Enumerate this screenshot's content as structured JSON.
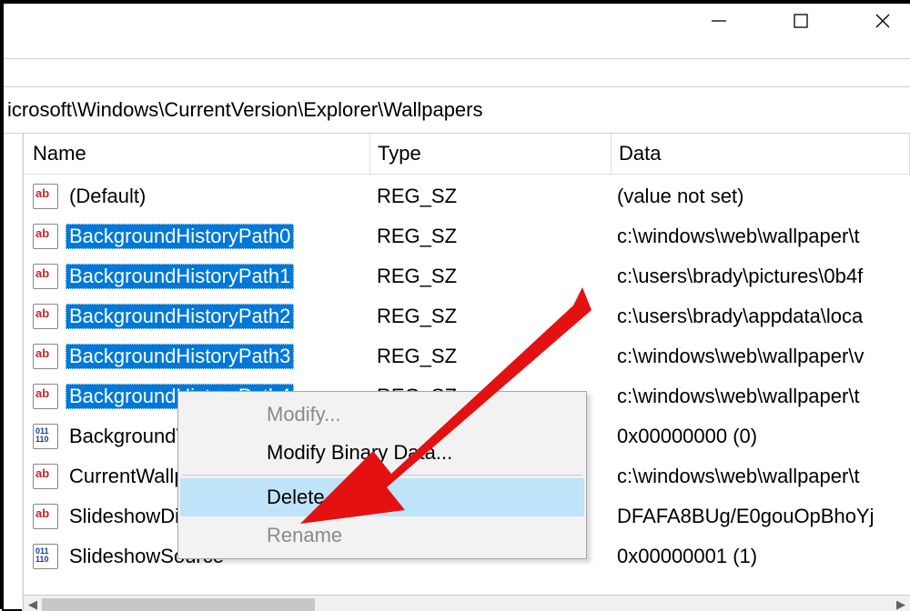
{
  "address": "icrosoft\\Windows\\CurrentVersion\\Explorer\\Wallpapers",
  "columns": {
    "name": "Name",
    "type": "Type",
    "data": "Data"
  },
  "rows": [
    {
      "name": "(Default)",
      "type": "REG_SZ",
      "data": "(value not set)",
      "icon": "ab",
      "selected": false
    },
    {
      "name": "BackgroundHistoryPath0",
      "type": "REG_SZ",
      "data": "c:\\windows\\web\\wallpaper\\t",
      "icon": "ab",
      "selected": true
    },
    {
      "name": "BackgroundHistoryPath1",
      "type": "REG_SZ",
      "data": "c:\\users\\brady\\pictures\\0b4f",
      "icon": "ab",
      "selected": true
    },
    {
      "name": "BackgroundHistoryPath2",
      "type": "REG_SZ",
      "data": "c:\\users\\brady\\appdata\\loca",
      "icon": "ab",
      "selected": true
    },
    {
      "name": "BackgroundHistoryPath3",
      "type": "REG_SZ",
      "data": "c:\\windows\\web\\wallpaper\\v",
      "icon": "ab",
      "selected": true
    },
    {
      "name": "BackgroundHistoryPath4",
      "type": "REG_SZ",
      "data": "c:\\windows\\web\\wallpaper\\t",
      "icon": "ab",
      "selected": true
    },
    {
      "name": "BackgroundType",
      "type": "",
      "data": "0x00000000 (0)",
      "icon": "bin",
      "selected": false
    },
    {
      "name": "CurrentWallpaper",
      "type": "",
      "data": "c:\\windows\\web\\wallpaper\\t",
      "icon": "ab",
      "selected": false
    },
    {
      "name": "SlideshowDirectories",
      "type": "",
      "data": "DFAFA8BUg/E0gouOpBhoYj",
      "icon": "ab",
      "selected": false
    },
    {
      "name": "SlideshowSource",
      "type": "",
      "data": "0x00000001 (1)",
      "icon": "bin",
      "selected": false
    }
  ],
  "context_menu": {
    "modify": "Modify...",
    "modify_binary": "Modify Binary Data...",
    "delete": "Delete",
    "rename": "Rename"
  }
}
